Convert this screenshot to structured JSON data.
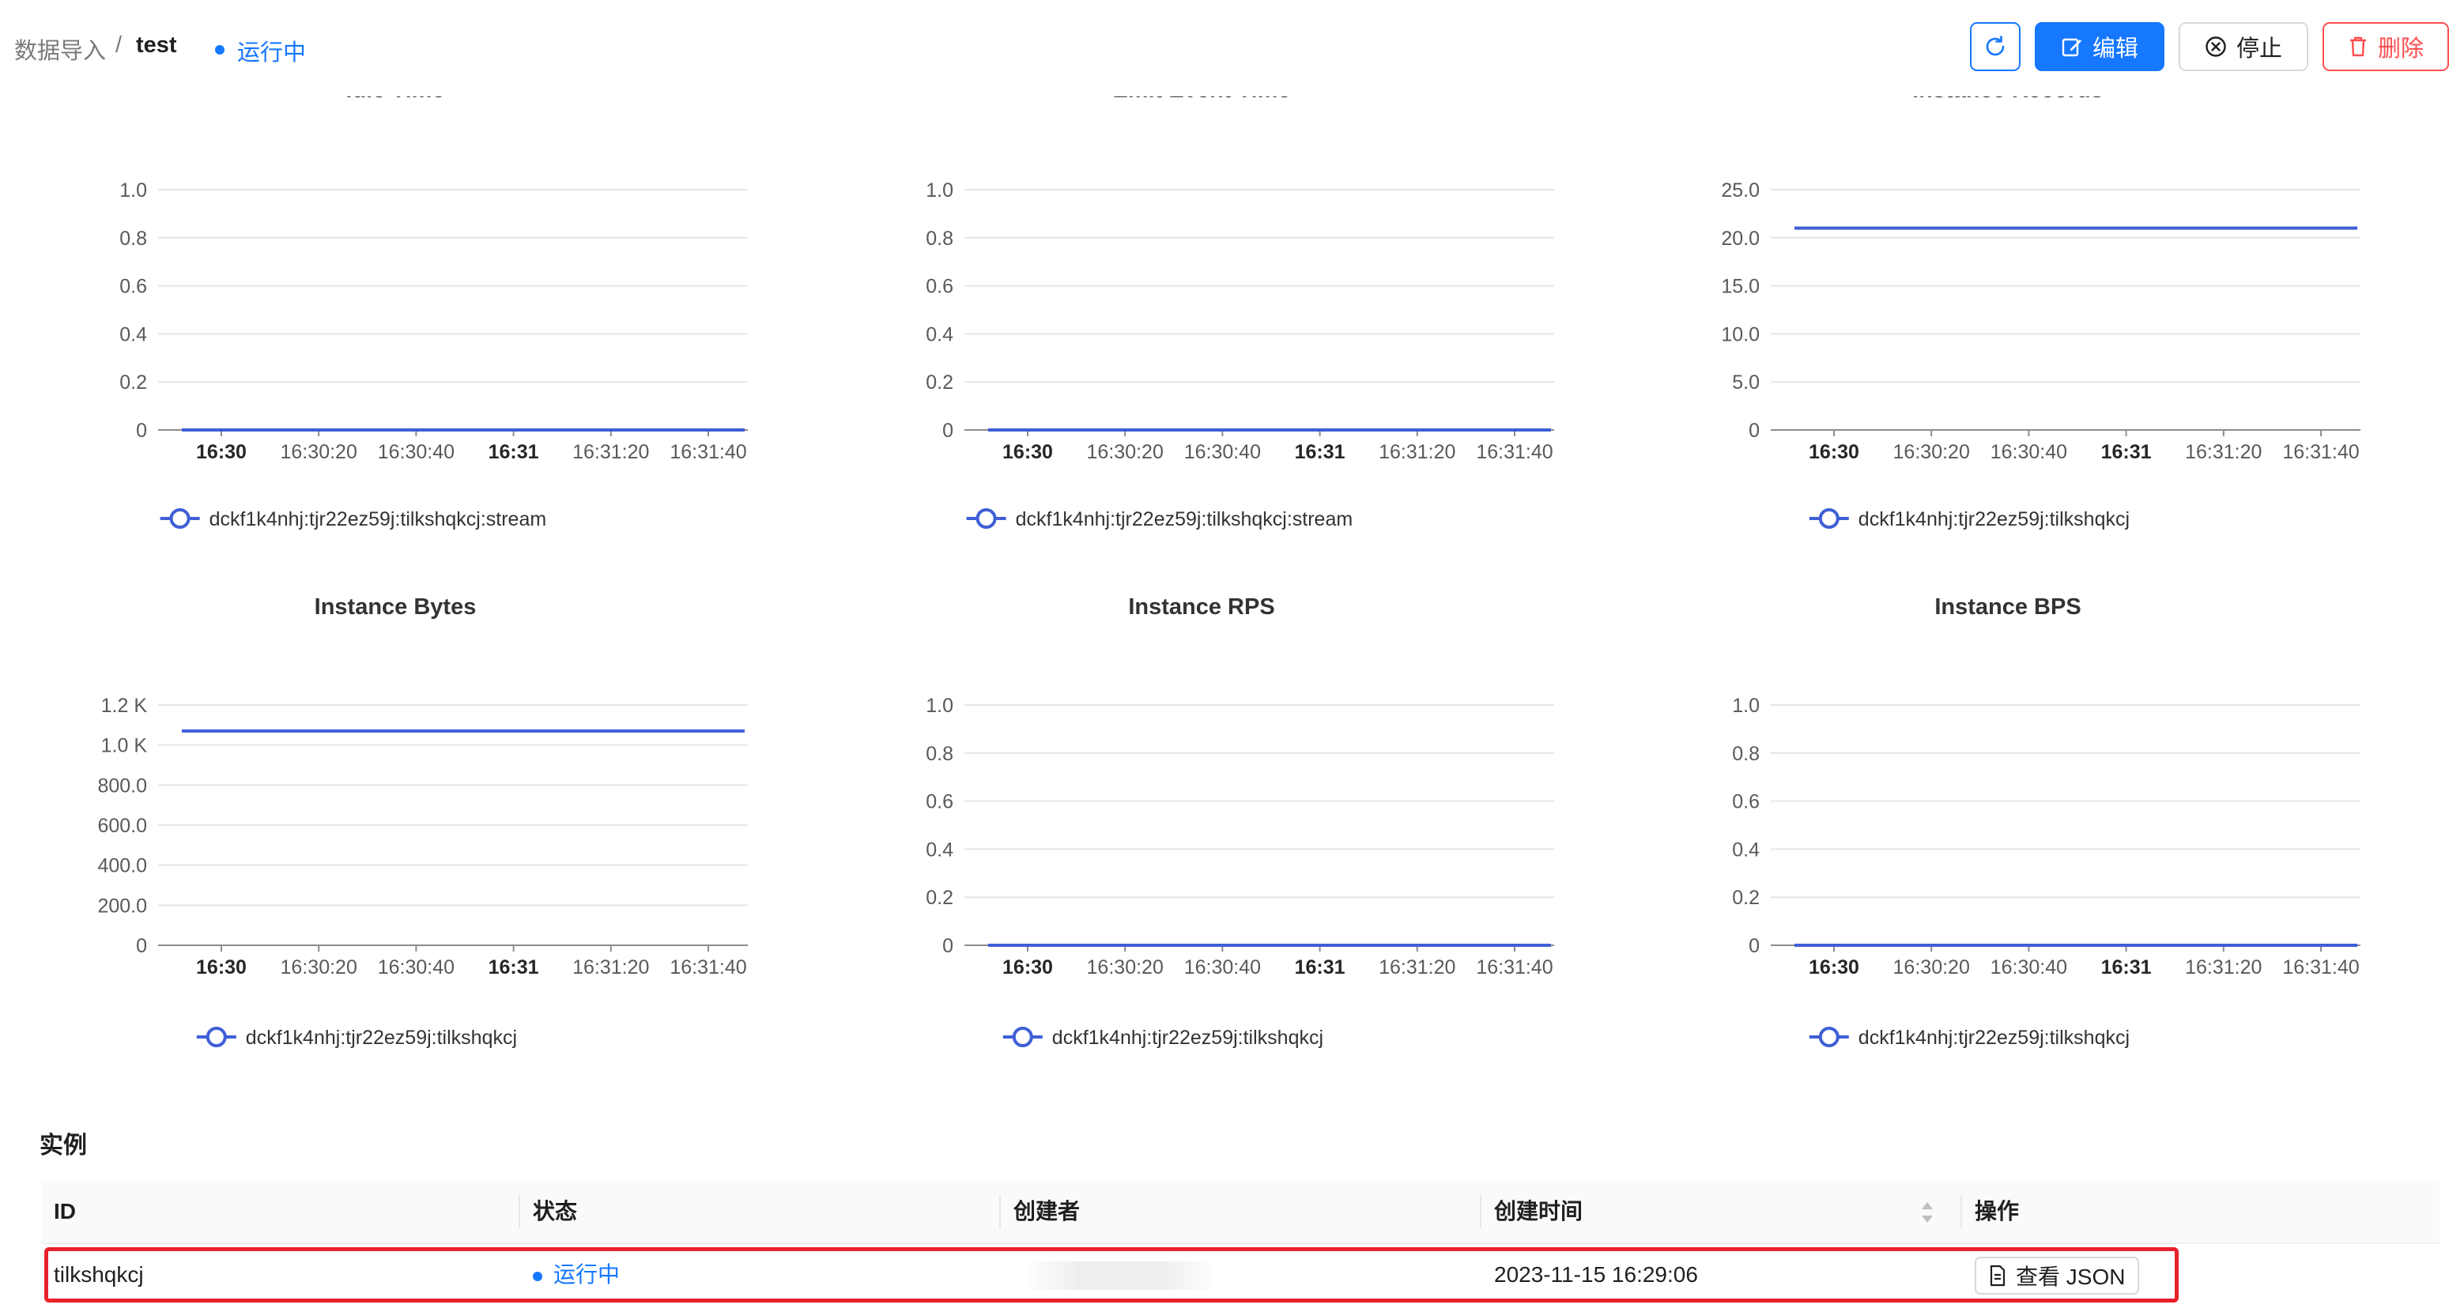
{
  "header": {
    "breadcrumb_parent": "数据导入",
    "breadcrumb_separator": "/",
    "breadcrumb_current": "test",
    "status": "运行中",
    "buttons": {
      "edit": "编辑",
      "stop": "停止",
      "delete": "删除"
    }
  },
  "colors": {
    "primary": "#1677ff",
    "danger": "#ff4d4f",
    "series": "#3f5fd6",
    "highlight": "#e8212b"
  },
  "chart_data": [
    {
      "type": "line",
      "title": "Idle Time",
      "x_ticks": [
        "16:30",
        "16:30:20",
        "16:30:40",
        "16:31",
        "16:31:20",
        "16:31:40"
      ],
      "x_ticks_bold": [
        "16:30",
        "16:31"
      ],
      "y_ticks": [
        "0",
        "0.2",
        "0.4",
        "0.6",
        "0.8",
        "1.0"
      ],
      "ylim": [
        0,
        1
      ],
      "series": [
        {
          "name": "dckf1k4nhj:tjr22ez59j:tilkshqkcj:stream",
          "values": [
            0,
            0
          ]
        }
      ],
      "grid": true,
      "legend": "bottom"
    },
    {
      "type": "line",
      "title": "Emit Event Time",
      "x_ticks": [
        "16:30",
        "16:30:20",
        "16:30:40",
        "16:31",
        "16:31:20",
        "16:31:40"
      ],
      "x_ticks_bold": [
        "16:30",
        "16:31"
      ],
      "y_ticks": [
        "0",
        "0.2",
        "0.4",
        "0.6",
        "0.8",
        "1.0"
      ],
      "ylim": [
        0,
        1
      ],
      "series": [
        {
          "name": "dckf1k4nhj:tjr22ez59j:tilkshqkcj:stream",
          "values": [
            0,
            0
          ]
        }
      ],
      "grid": true,
      "legend": "bottom"
    },
    {
      "type": "line",
      "title": "Instance Records",
      "x_ticks": [
        "16:30",
        "16:30:20",
        "16:30:40",
        "16:31",
        "16:31:20",
        "16:31:40"
      ],
      "x_ticks_bold": [
        "16:30",
        "16:31"
      ],
      "y_ticks": [
        "0",
        "5.0",
        "10.0",
        "15.0",
        "20.0",
        "25.0"
      ],
      "ylim": [
        0,
        25
      ],
      "series": [
        {
          "name": "dckf1k4nhj:tjr22ez59j:tilkshqkcj",
          "values": [
            21,
            21
          ]
        }
      ],
      "grid": true,
      "legend": "bottom"
    },
    {
      "type": "line",
      "title": "Instance Bytes",
      "x_ticks": [
        "16:30",
        "16:30:20",
        "16:30:40",
        "16:31",
        "16:31:20",
        "16:31:40"
      ],
      "x_ticks_bold": [
        "16:30",
        "16:31"
      ],
      "y_ticks": [
        "0",
        "200.0",
        "400.0",
        "600.0",
        "800.0",
        "1.0 K",
        "1.2 K"
      ],
      "ylim": [
        0,
        1200
      ],
      "series": [
        {
          "name": "dckf1k4nhj:tjr22ez59j:tilkshqkcj",
          "values": [
            1070,
            1070
          ]
        }
      ],
      "grid": true,
      "legend": "bottom"
    },
    {
      "type": "line",
      "title": "Instance RPS",
      "x_ticks": [
        "16:30",
        "16:30:20",
        "16:30:40",
        "16:31",
        "16:31:20",
        "16:31:40"
      ],
      "x_ticks_bold": [
        "16:30",
        "16:31"
      ],
      "y_ticks": [
        "0",
        "0.2",
        "0.4",
        "0.6",
        "0.8",
        "1.0"
      ],
      "ylim": [
        0,
        1
      ],
      "series": [
        {
          "name": "dckf1k4nhj:tjr22ez59j:tilkshqkcj",
          "values": [
            0,
            0
          ]
        }
      ],
      "grid": true,
      "legend": "bottom"
    },
    {
      "type": "line",
      "title": "Instance BPS",
      "x_ticks": [
        "16:30",
        "16:30:20",
        "16:30:40",
        "16:31",
        "16:31:20",
        "16:31:40"
      ],
      "x_ticks_bold": [
        "16:30",
        "16:31"
      ],
      "y_ticks": [
        "0",
        "0.2",
        "0.4",
        "0.6",
        "0.8",
        "1.0"
      ],
      "ylim": [
        0,
        1
      ],
      "series": [
        {
          "name": "dckf1k4nhj:tjr22ez59j:tilkshqkcj",
          "values": [
            0,
            0
          ]
        }
      ],
      "grid": true,
      "legend": "bottom"
    }
  ],
  "instances": {
    "title": "实例",
    "columns": [
      "ID",
      "状态",
      "创建者",
      "创建时间",
      "操作"
    ],
    "rows": [
      {
        "id": "tilkshqkcj",
        "status": "运行中",
        "creator": "",
        "created_at": "2023-11-15 16:29:06",
        "action": "查看 JSON"
      }
    ]
  }
}
